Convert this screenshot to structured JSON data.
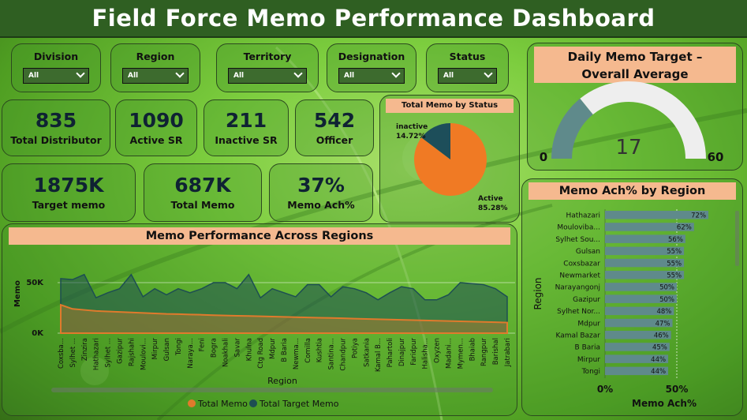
{
  "header": {
    "title": "Field Force Memo Performance Dashboard"
  },
  "filters": [
    {
      "label": "Division",
      "value": "All"
    },
    {
      "label": "Region",
      "value": "All"
    },
    {
      "label": "Territory",
      "value": "All"
    },
    {
      "label": "Designation",
      "value": "All"
    },
    {
      "label": "Status",
      "value": "All"
    }
  ],
  "kpis": {
    "total_distributor": {
      "value": "835",
      "label": "Total Distributor"
    },
    "active_sr": {
      "value": "1090",
      "label": "Active SR"
    },
    "inactive_sr": {
      "value": "211",
      "label": "Inactive SR"
    },
    "officer": {
      "value": "542",
      "label": "Officer"
    },
    "target_memo": {
      "value": "1875K",
      "label": "Target memo"
    },
    "total_memo": {
      "value": "687K",
      "label": "Total Memo"
    },
    "memo_ach": {
      "value": "37%",
      "label": "Memo Ach%"
    }
  },
  "pie": {
    "title": "Total Memo by Status",
    "inactive_label": "inactive",
    "inactive_pct": "14.72%",
    "active_label": "Active",
    "active_pct": "85.28%",
    "colors": {
      "active": "#f07a24",
      "inactive": "#1d4e5a"
    }
  },
  "gauge": {
    "title_line1": "Daily Memo Target –",
    "title_line2": "Overall Average",
    "value": "17",
    "min": "0",
    "max": "60",
    "fraction": 0.2833,
    "colors": {
      "fill": "#5f8a8b",
      "rest": "#eeeeee"
    }
  },
  "area": {
    "title": "Memo Performance Across Regions",
    "xlabel": "Region",
    "ylabel": "Memo",
    "yticks": [
      "50K",
      "0K"
    ],
    "legend": [
      {
        "name": "Total Memo",
        "color": "#e07a2c"
      },
      {
        "name": "Total Target Memo",
        "color": "#1d4e52"
      }
    ]
  },
  "bars": {
    "title": "Memo Ach% by Region",
    "ylabel": "Region",
    "xlabel": "Memo Ach%",
    "xticks": [
      "0%",
      "50%"
    ],
    "color": "#5f8a8b"
  },
  "chart_data": [
    {
      "type": "area",
      "title": "Memo Performance Across Regions",
      "xlabel": "Region",
      "ylabel": "Memo",
      "ylim": [
        0,
        60000
      ],
      "categories": [
        "Coxsba...",
        "Sylhet ...",
        "Zinzira",
        "Hathazari",
        "Sylhet ...",
        "Gazipur",
        "Rajshahi",
        "Moulovi...",
        "Mirpur",
        "Gulsan",
        "Tongi",
        "Naraya...",
        "Feni",
        "Bogra",
        "Noakhali",
        "Savar",
        "Khulna",
        "Ctg Road",
        "Mdpur",
        "B Baria",
        "Newma...",
        "Comilla",
        "Kushtia",
        "Santina...",
        "Chandpur",
        "Potiya",
        "Satkania",
        "Kamal B...",
        "Pahartoli",
        "Dinajpur",
        "Faridpur",
        "Halisha...",
        "Oxyzen",
        "Madani...",
        "Mymen...",
        "Bhaiab",
        "Rangpur",
        "Barishal",
        "Jatrabari"
      ],
      "series": [
        {
          "name": "Total Target Memo",
          "values": [
            54000,
            53000,
            58000,
            35000,
            40000,
            44000,
            58000,
            36000,
            44000,
            38000,
            44000,
            40000,
            44000,
            50000,
            50000,
            44000,
            58000,
            35000,
            44000,
            40000,
            36000,
            48000,
            48000,
            36000,
            46000,
            44000,
            40000,
            33000,
            40000,
            46000,
            44000,
            33000,
            33000,
            38000,
            50000,
            49000,
            48000,
            44000,
            36000
          ]
        },
        {
          "name": "Total Memo",
          "values": [
            28000,
            24000,
            23000,
            22000,
            21500,
            21000,
            20500,
            20000,
            19500,
            19000,
            18800,
            18500,
            18200,
            17800,
            17500,
            17200,
            17000,
            16700,
            16400,
            16100,
            15800,
            15500,
            15200,
            15000,
            14700,
            14400,
            14100,
            13800,
            13500,
            13200,
            12900,
            12600,
            12300,
            12000,
            11700,
            11400,
            11100,
            10800,
            10500
          ]
        }
      ]
    },
    {
      "type": "pie",
      "title": "Total Memo by Status",
      "categories": [
        "Active",
        "inactive"
      ],
      "values": [
        85.28,
        14.72
      ]
    },
    {
      "type": "bar",
      "orientation": "horizontal",
      "title": "Memo Ach% by Region",
      "xlabel": "Memo Ach%",
      "ylabel": "Region",
      "xlim": [
        0,
        80
      ],
      "categories": [
        "Hathazari",
        "Mouloviba...",
        "Sylhet Sou...",
        "Gulsan",
        "Coxsbazar",
        "Newmarket",
        "Narayangonj",
        "Gazipur",
        "Sylhet Nor...",
        "Mdpur",
        "Kamal Bazar",
        "B Baria",
        "Mirpur",
        "Tongi"
      ],
      "values": [
        72,
        62,
        56,
        55,
        55,
        55,
        50,
        50,
        48,
        47,
        46,
        45,
        44,
        44
      ],
      "labels": [
        "72%",
        "62%",
        "56%",
        "55%",
        "55%",
        "55%",
        "50%",
        "50%",
        "48%",
        "47%",
        "46%",
        "45%",
        "44%",
        "44%"
      ]
    }
  ]
}
